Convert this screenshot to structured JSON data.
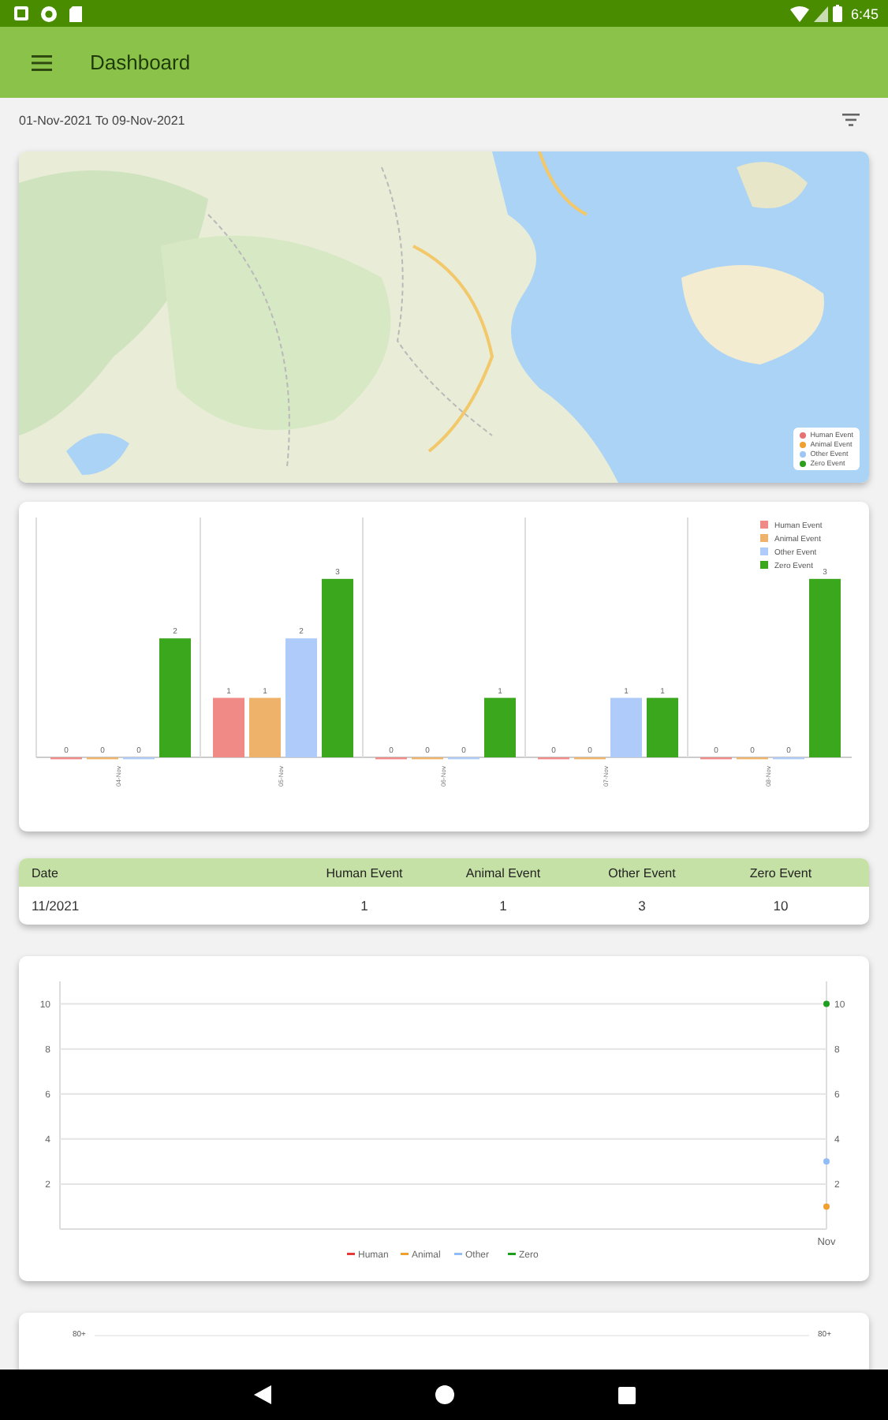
{
  "status_bar": {
    "time": "6:45"
  },
  "toolbar": {
    "title": "Dashboard"
  },
  "date_range": "01-Nov-2021 To 09-Nov-2021",
  "map": {
    "kind": "picture",
    "legend": [
      {
        "label": "Human Event",
        "color": "#e57373"
      },
      {
        "label": "Animal Event",
        "color": "#f0a030"
      },
      {
        "label": "Other Event",
        "color": "#9fc5f8"
      },
      {
        "label": "Zero Event",
        "color": "#2e9e1e"
      }
    ]
  },
  "bar_chart": {
    "chart_data": {
      "type": "bar",
      "categories": [
        "04-Nov",
        "05-Nov",
        "06-Nov",
        "07-Nov",
        "08-Nov"
      ],
      "data_labels": true,
      "legend": "top-right",
      "series": [
        {
          "name": "Human Event",
          "color": "#ef8a87",
          "values": [
            0,
            1,
            0,
            0,
            0
          ]
        },
        {
          "name": "Animal Event",
          "color": "#efb26a",
          "values": [
            0,
            1,
            0,
            0,
            0
          ]
        },
        {
          "name": "Other Event",
          "color": "#aecbfa",
          "values": [
            0,
            2,
            0,
            1,
            0
          ]
        },
        {
          "name": "Zero Event",
          "color": "#3aa71c",
          "values": [
            2,
            3,
            1,
            1,
            3
          ]
        }
      ]
    }
  },
  "table": {
    "columns": [
      "Date",
      "Human Event",
      "Animal Event",
      "Other Event",
      "Zero Event"
    ],
    "rows": [
      [
        "11/2021",
        "1",
        "1",
        "3",
        "10"
      ]
    ]
  },
  "line_chart": {
    "chart_data": {
      "type": "line",
      "x": [
        "Nov"
      ],
      "yticks": [
        2,
        4,
        6,
        8,
        10
      ],
      "ylim": [
        0,
        11
      ],
      "grid": true,
      "legend": "bottom",
      "series": [
        {
          "name": "Human",
          "color": "#e53935",
          "values": [
            null
          ]
        },
        {
          "name": "Animal",
          "color": "#f0a030",
          "marker": "circle",
          "values": [
            1
          ]
        },
        {
          "name": "Other",
          "color": "#90bdf5",
          "marker": "circle",
          "values": [
            3
          ]
        },
        {
          "name": "Zero",
          "color": "#1e9e1e",
          "marker": "circle",
          "values": [
            10
          ]
        }
      ]
    },
    "left_axis_labels": [
      "10",
      "8",
      "6",
      "4",
      "2"
    ]
  },
  "bottom_chart": {
    "axis_labels": [
      "80+",
      "80+"
    ]
  }
}
